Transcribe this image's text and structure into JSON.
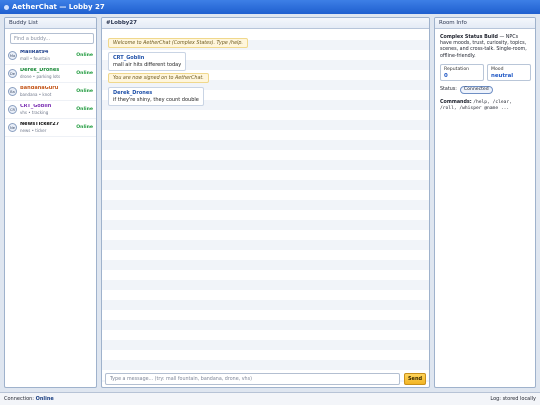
{
  "window": {
    "title": "AetherChat — Lobby 27"
  },
  "buddy_list": {
    "title": "Buddy List",
    "search_placeholder": "Find a buddy...",
    "items": [
      {
        "initials": "Ma",
        "name": "MallRat94",
        "sub": "mall • fountain",
        "status": "Online",
        "name_color": "#1d3f8c"
      },
      {
        "initials": "De",
        "name": "Derek_Drones",
        "sub": "drone • parking lots",
        "status": "Online",
        "name_color": "#1b8a3a"
      },
      {
        "initials": "Ba",
        "name": "BandanaGuru",
        "sub": "bandana • knot",
        "status": "Online",
        "name_color": "#c4561a"
      },
      {
        "initials": "CR",
        "name": "CRT_Goblin",
        "sub": "vhs • tracking",
        "status": "Online",
        "name_color": "#7a2fb3"
      },
      {
        "initials": "Ne",
        "name": "NewsTicker27",
        "sub": "news • ticker",
        "status": "Online",
        "name_color": "#111111"
      }
    ]
  },
  "chat": {
    "title": "#Lobby27",
    "messages": [
      {
        "kind": "system",
        "text": "Welcome to AetherChat (Complex States). Type /help."
      },
      {
        "kind": "user",
        "author": "CRT_Goblin",
        "text": "mall air hits different today"
      },
      {
        "kind": "system",
        "text": "You are now signed on to AetherChat."
      },
      {
        "kind": "user",
        "author": "Derek_Drones",
        "text": "if they're shiny, they count double"
      }
    ],
    "input_placeholder": "Type a message... (try: mall fountain, bandana, drone, vhs)",
    "send_label": "Send"
  },
  "room_info": {
    "title": "Room Info",
    "build_label": "Complex Status Build",
    "build_desc": " — NPCs have moods, trust, curiosity, topics, scenes, and cross-talk. Single-room, offline-friendly.",
    "reputation_label": "Reputation",
    "reputation_value": "0",
    "mood_label": "Mood",
    "mood_value": "neutral",
    "status_label": "Status:",
    "status_value": "Connected",
    "commands_label": "Commands:",
    "commands_value": "/help, /clear, /roll, /whisper @name ..."
  },
  "footer": {
    "connection_label": "Connection:",
    "connection_value": "Online",
    "log_text": "Log: stored locally"
  }
}
